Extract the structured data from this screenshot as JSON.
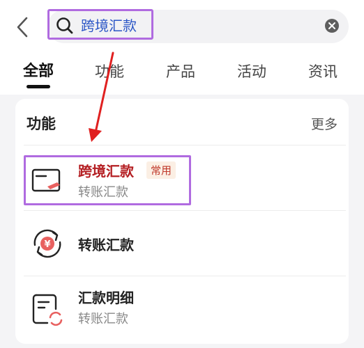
{
  "search": {
    "query": "跨境汇款"
  },
  "tabs": [
    {
      "label": "全部"
    },
    {
      "label": "功能"
    },
    {
      "label": "产品"
    },
    {
      "label": "活动"
    },
    {
      "label": "资讯"
    }
  ],
  "section": {
    "title": "功能",
    "more": "更多"
  },
  "results": [
    {
      "title": "跨境汇款",
      "badge": "常用",
      "subtitle": "转账汇款",
      "icon": "remittance-card-icon"
    },
    {
      "title": "转账汇款",
      "icon": "yuan-exchange-icon"
    },
    {
      "title": "汇款明细",
      "subtitle": "转账汇款",
      "icon": "document-refresh-icon"
    }
  ],
  "colors": {
    "accent": "#2b56c6",
    "highlight": "#b06be0",
    "annotation": "#e02020",
    "title_red": "#b41e22"
  }
}
